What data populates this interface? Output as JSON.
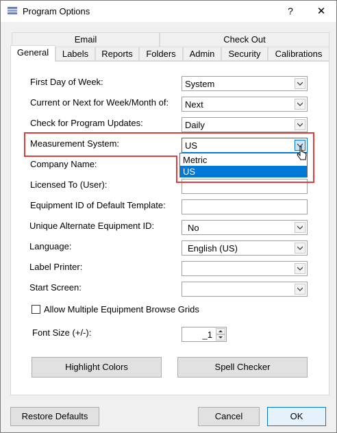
{
  "window": {
    "title": "Program Options",
    "help_label": "?",
    "close_label": "✕"
  },
  "tabs_row1": [
    "Email",
    "Check Out"
  ],
  "tabs_row2": [
    "General",
    "Labels",
    "Reports",
    "Folders",
    "Admin",
    "Security",
    "Calibrations"
  ],
  "form": {
    "first_day": {
      "label": "First Day of Week:",
      "value": "System"
    },
    "current_next": {
      "label": "Current or Next for Week/Month of:",
      "value": "Next"
    },
    "check_updates": {
      "label": "Check for Program Updates:",
      "value": "Daily"
    },
    "measurement": {
      "label": "Measurement System:",
      "value": "US",
      "options": [
        "Metric",
        "US"
      ],
      "selected": "US"
    },
    "company_name": {
      "label": "Company Name:",
      "value": ""
    },
    "licensed_to": {
      "label": "Licensed To (User):",
      "value": ""
    },
    "equipment_id": {
      "label": "Equipment ID of Default Template:",
      "value": ""
    },
    "unique_alt_id": {
      "label": "Unique Alternate Equipment ID:",
      "value": "No"
    },
    "language": {
      "label": "Language:",
      "value": "English (US)"
    },
    "label_printer": {
      "label": "Label Printer:",
      "value": ""
    },
    "start_screen": {
      "label": "Start Screen:",
      "value": ""
    },
    "allow_multiple": {
      "label": "Allow Multiple Equipment Browse Grids",
      "checked": false
    },
    "font_size": {
      "label": "Font Size (+/-):",
      "value": "_1"
    }
  },
  "buttons": {
    "highlight_colors": "Highlight Colors",
    "spell_checker": "Spell Checker",
    "restore_defaults": "Restore Defaults",
    "cancel": "Cancel",
    "ok": "OK"
  },
  "colors": {
    "accent": "#0078d7",
    "highlight_box": "#e03c3c"
  }
}
